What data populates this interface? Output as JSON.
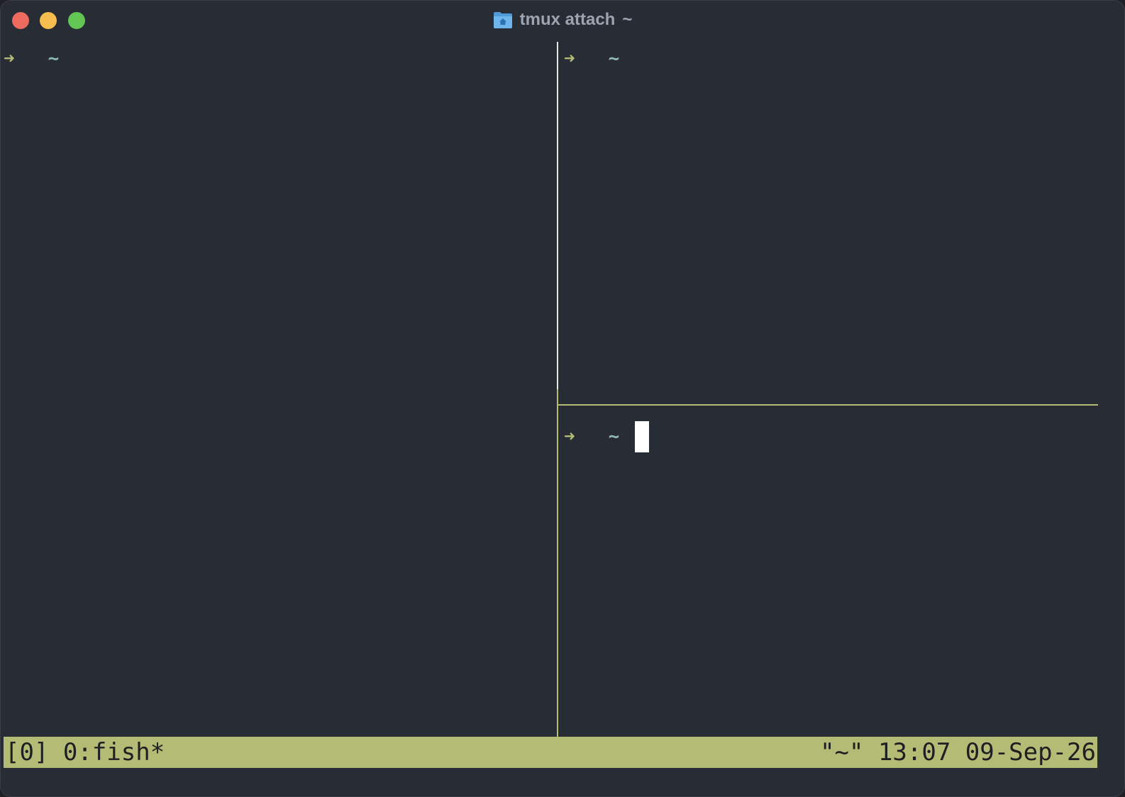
{
  "colors": {
    "window_bg": "#282c35",
    "close": "#ee6a5f",
    "minimize": "#f5be4f",
    "maximize": "#62c554",
    "prompt_arrow": "#b3bb75",
    "prompt_tilde": "#8fb8b0",
    "active_border": "#b3bb75",
    "status_bg": "#b3bb74",
    "folder_icon": "#5aa6e4"
  },
  "window": {
    "title": "tmux attach",
    "title_suffix": "~",
    "title_icon": "home-folder-icon"
  },
  "panes": [
    {
      "id": "left",
      "arrow": "➜",
      "dir": "~",
      "active": false
    },
    {
      "id": "top-right",
      "arrow": "➜",
      "dir": "~",
      "active": false
    },
    {
      "id": "bottom-right",
      "arrow": "➜",
      "dir": "~",
      "active": true
    }
  ],
  "statusbar": {
    "left": "[0] 0:fish*",
    "right": "\"~\" 13:07 09-Sep-26"
  }
}
